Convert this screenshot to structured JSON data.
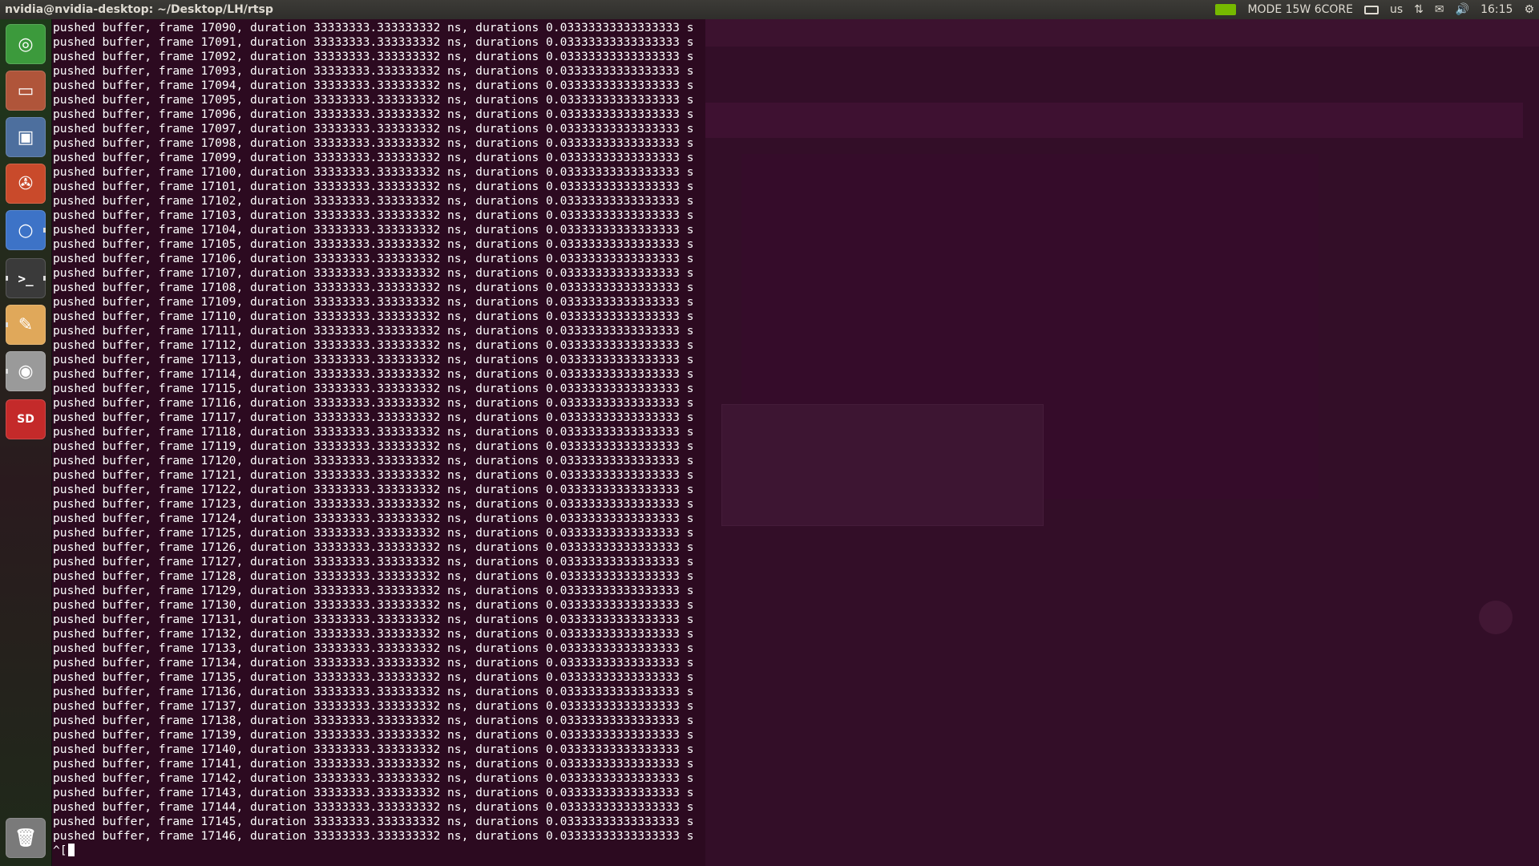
{
  "topbar": {
    "window_title": "nvidia@nvidia-desktop: ~/Desktop/LH/rtsp",
    "power_mode": "MODE 15W 6CORE",
    "keyboard_layout": "us",
    "clock": "16:15"
  },
  "launcher": {
    "items": [
      {
        "name": "chromium-icon"
      },
      {
        "name": "files-icon"
      },
      {
        "name": "software-center-icon"
      },
      {
        "name": "system-settings-icon"
      },
      {
        "name": "chrome-icon"
      },
      {
        "name": "terminal-icon",
        "glyph": ">_"
      },
      {
        "name": "text-editor-icon"
      },
      {
        "name": "camera-icon"
      },
      {
        "name": "sd-card-icon",
        "glyph": "SD"
      },
      {
        "name": "trash-icon"
      }
    ]
  },
  "terminal": {
    "line_prefix": "pushed buffer, frame ",
    "line_suffix": ", duration 33333333.333333332 ns, durations 0.03333333333333333 s",
    "first_frame": 17090,
    "last_frame": 17146,
    "prompt_text": "^["
  },
  "colors": {
    "terminal_bg": "#2c0a20",
    "nvidia_green": "#76b900"
  }
}
